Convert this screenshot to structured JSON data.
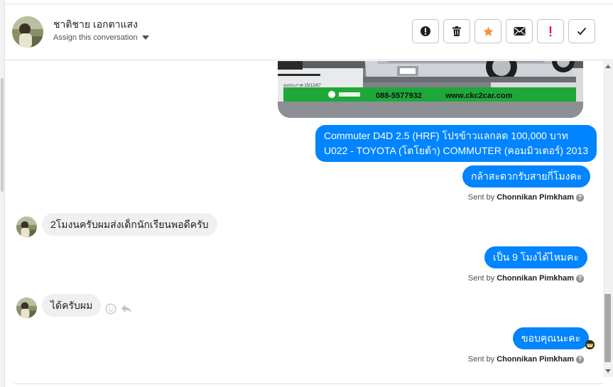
{
  "header": {
    "contact_name": "ชาติชาย เอกตาแสง",
    "assign_label": "Assign this conversation",
    "actions": [
      {
        "name": "mark-spam-button",
        "icon": "exclamation-circle-icon"
      },
      {
        "name": "delete-button",
        "icon": "trash-icon"
      },
      {
        "name": "star-button",
        "icon": "star-icon"
      },
      {
        "name": "mark-unread-button",
        "icon": "envelope-icon"
      },
      {
        "name": "follow-up-button",
        "icon": "exclamation-icon"
      },
      {
        "name": "mark-done-button",
        "icon": "checkmark-icon"
      }
    ],
    "colors": {
      "star": "#f5923e",
      "follow_up": "#e41e3f"
    }
  },
  "image_banner": {
    "phone": "088-5577932",
    "website": "www.ckc2car.com",
    "caption_small": "ลงประกาศ 15/12/67"
  },
  "messages": {
    "out_1_line1": "Commuter D4D 2.5 (HRF) โปรข้าวแลกลด 100,000 บาท",
    "out_1_line2": "U022 - TOYOTA (โตโยต้า) COMMUTER (คอมมิวเตอร์) 2013",
    "out_2": "กล้าสะดวกรับสายกี่โมงคะ",
    "in_1": "2โมงนครับผมส่งเด็กนักเรียนพอดีครับ",
    "out_3": "เป็น 9 โมงได้ไหมคะ",
    "in_2": "ได้ครับผม",
    "out_4": "ขอบคุณนะคะ"
  },
  "sent_by": {
    "prefix": "Sent by",
    "agent": "Chonnikan Pimkham",
    "help": "?"
  },
  "colors": {
    "outgoing_bubble": "#0084ff",
    "incoming_bubble": "#f1f0f0",
    "banner_green": "#1fa83a"
  }
}
